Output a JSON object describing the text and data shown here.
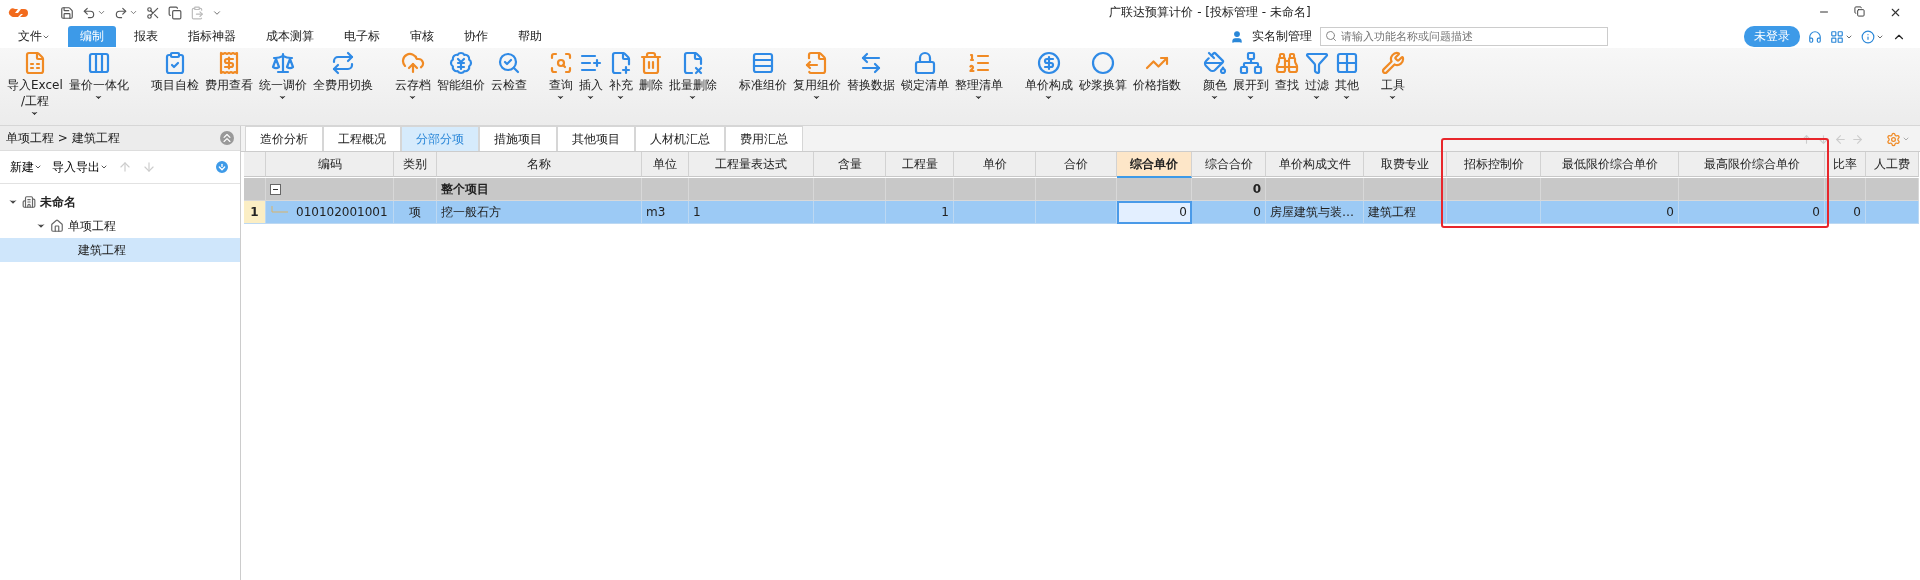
{
  "window": {
    "title": "广联达预算计价 - [投标管理 - 未命名]"
  },
  "menu": [
    {
      "label": "文件",
      "dropdown": true,
      "selected": false
    },
    {
      "label": "编制",
      "dropdown": false,
      "selected": true
    },
    {
      "label": "报表",
      "dropdown": false,
      "selected": false
    },
    {
      "label": "指标神器",
      "dropdown": false,
      "selected": false
    },
    {
      "label": "成本测算",
      "dropdown": false,
      "selected": false
    },
    {
      "label": "电子标",
      "dropdown": false,
      "selected": false
    },
    {
      "label": "审核",
      "dropdown": false,
      "selected": false
    },
    {
      "label": "协作",
      "dropdown": false,
      "selected": false
    },
    {
      "label": "帮助",
      "dropdown": false,
      "selected": false
    }
  ],
  "account": {
    "realname": "实名制管理",
    "search_placeholder": "请输入功能名称或问题描述",
    "login": "未登录"
  },
  "toolbar": [
    [
      {
        "label": "导入Excel\n/工程",
        "dropdown": true
      },
      {
        "label": "量价一体化",
        "dropdown": true
      }
    ],
    [
      {
        "label": "项目自检",
        "dropdown": false
      },
      {
        "label": "费用查看",
        "dropdown": false
      },
      {
        "label": "统一调价",
        "dropdown": true
      },
      {
        "label": "全费用切换",
        "dropdown": false
      }
    ],
    [
      {
        "label": "云存档",
        "dropdown": true
      },
      {
        "label": "智能组价",
        "dropdown": false
      },
      {
        "label": "云检查",
        "dropdown": false
      }
    ],
    [
      {
        "label": "查询",
        "dropdown": true
      },
      {
        "label": "插入",
        "dropdown": true
      },
      {
        "label": "补充",
        "dropdown": true
      },
      {
        "label": "删除",
        "dropdown": false
      },
      {
        "label": "批量删除",
        "dropdown": true
      }
    ],
    [
      {
        "label": "标准组价",
        "dropdown": false
      },
      {
        "label": "复用组价",
        "dropdown": true
      },
      {
        "label": "替换数据",
        "dropdown": false
      },
      {
        "label": "锁定清单",
        "dropdown": false
      },
      {
        "label": "整理清单",
        "dropdown": true
      }
    ],
    [
      {
        "label": "单价构成",
        "dropdown": true
      },
      {
        "label": "砂浆换算",
        "dropdown": false
      },
      {
        "label": "价格指数",
        "dropdown": false
      }
    ],
    [
      {
        "label": "颜色",
        "dropdown": true
      },
      {
        "label": "展开到",
        "dropdown": true
      },
      {
        "label": "查找",
        "dropdown": false
      },
      {
        "label": "过滤",
        "dropdown": true
      },
      {
        "label": "其他",
        "dropdown": true
      }
    ],
    [
      {
        "label": "工具",
        "dropdown": true
      }
    ]
  ],
  "sidebar": {
    "breadcrumb": "单项工程 > 建筑工程",
    "actions": [
      {
        "label": "新建",
        "dropdown": true
      },
      {
        "label": "导入导出",
        "dropdown": true
      }
    ],
    "tree": [
      {
        "label": "未命名",
        "expanded": true,
        "selected": false,
        "children": [
          {
            "label": "单项工程",
            "expanded": true,
            "selected": false,
            "children": [
              {
                "label": "建筑工程",
                "selected": true
              }
            ]
          }
        ]
      }
    ]
  },
  "tabs": [
    {
      "label": "造价分析",
      "selected": false
    },
    {
      "label": "工程概况",
      "selected": false
    },
    {
      "label": "分部分项",
      "selected": true
    },
    {
      "label": "措施项目",
      "selected": false
    },
    {
      "label": "其他项目",
      "selected": false
    },
    {
      "label": "人材机汇总",
      "selected": false
    },
    {
      "label": "费用汇总",
      "selected": false
    }
  ],
  "table": {
    "columns": [
      {
        "selected": false
      },
      {
        "label": "编码",
        "selected": false
      },
      {
        "label": "类别",
        "selected": false
      },
      {
        "label": "名称",
        "selected": false
      },
      {
        "label": "单位",
        "selected": false
      },
      {
        "label": "工程量表达式",
        "selected": false
      },
      {
        "label": "含量",
        "selected": false
      },
      {
        "label": "工程量",
        "selected": false
      },
      {
        "label": "单价",
        "selected": false
      },
      {
        "label": "合价",
        "selected": false
      },
      {
        "label": "综合单价",
        "selected": true
      },
      {
        "label": "综合合价",
        "selected": false
      },
      {
        "label": "单价构成文件",
        "selected": false
      },
      {
        "label": "取费专业",
        "selected": false
      },
      {
        "label": "招标控制价",
        "selected": false
      },
      {
        "label": "最低限价综合单价",
        "selected": false
      },
      {
        "label": "最高限价综合单价",
        "selected": false
      },
      {
        "label": "比率",
        "selected": false
      },
      {
        "label": "人工费",
        "selected": false
      }
    ],
    "rows": [
      {
        "kind": "group",
        "expanded": true,
        "selected": false,
        "cells": [
          null,
          null,
          null,
          "整个项目",
          null,
          null,
          null,
          null,
          null,
          null,
          null,
          "0",
          null,
          null,
          null,
          null,
          null,
          null,
          null
        ]
      },
      {
        "kind": "item",
        "selected": true,
        "cells": [
          "1",
          "010102001001",
          "项",
          "挖一般石方",
          "m3",
          "1",
          null,
          "1",
          null,
          null,
          "0",
          "0",
          "房屋建筑与装…",
          "建筑工程",
          null,
          "0",
          "0",
          "0",
          null
        ]
      }
    ]
  },
  "annotation": {
    "kind": "frame",
    "color": "#e8262b"
  }
}
